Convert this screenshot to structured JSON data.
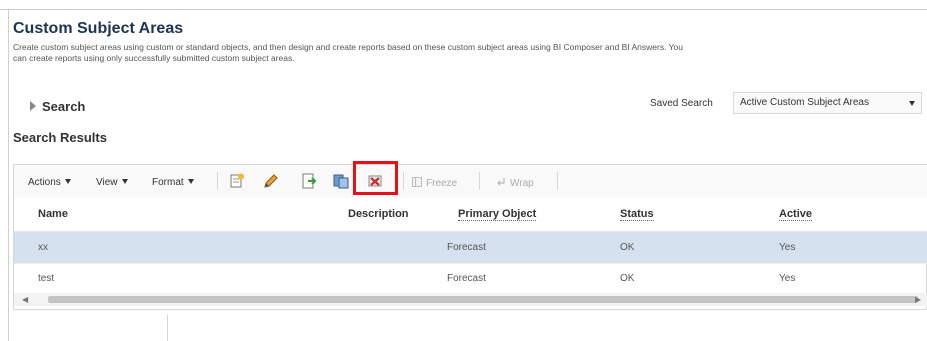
{
  "page": {
    "title": "Custom Subject Areas",
    "description": "Create custom subject areas using custom or standard objects, and then design and create reports based on these custom subject areas using BI Composer and BI Answers. You can create reports using only successfully submitted custom subject areas."
  },
  "search": {
    "toggle_label": "Search",
    "saved_search_label": "Saved Search",
    "saved_search_value": "Active Custom Subject Areas"
  },
  "results": {
    "title": "Search Results",
    "toolbar": {
      "actions_label": "Actions",
      "view_label": "View",
      "format_label": "Format",
      "freeze_label": "Freeze",
      "wrap_label": "Wrap"
    },
    "columns": {
      "name": "Name",
      "description": "Description",
      "primary_object": "Primary Object",
      "status": "Status",
      "active": "Active"
    },
    "rows": [
      {
        "name": "xx",
        "description": "",
        "primary_object": "Forecast",
        "status": "OK",
        "active": "Yes"
      },
      {
        "name": "test",
        "description": "",
        "primary_object": "Forecast",
        "status": "OK",
        "active": "Yes"
      }
    ],
    "scroll": {
      "left_arrow": "◀",
      "right_arrow": "▶"
    }
  },
  "colors": {
    "title": "#1e3452",
    "selected_row": "#d6e1ef",
    "highlight": "#e2121b"
  }
}
